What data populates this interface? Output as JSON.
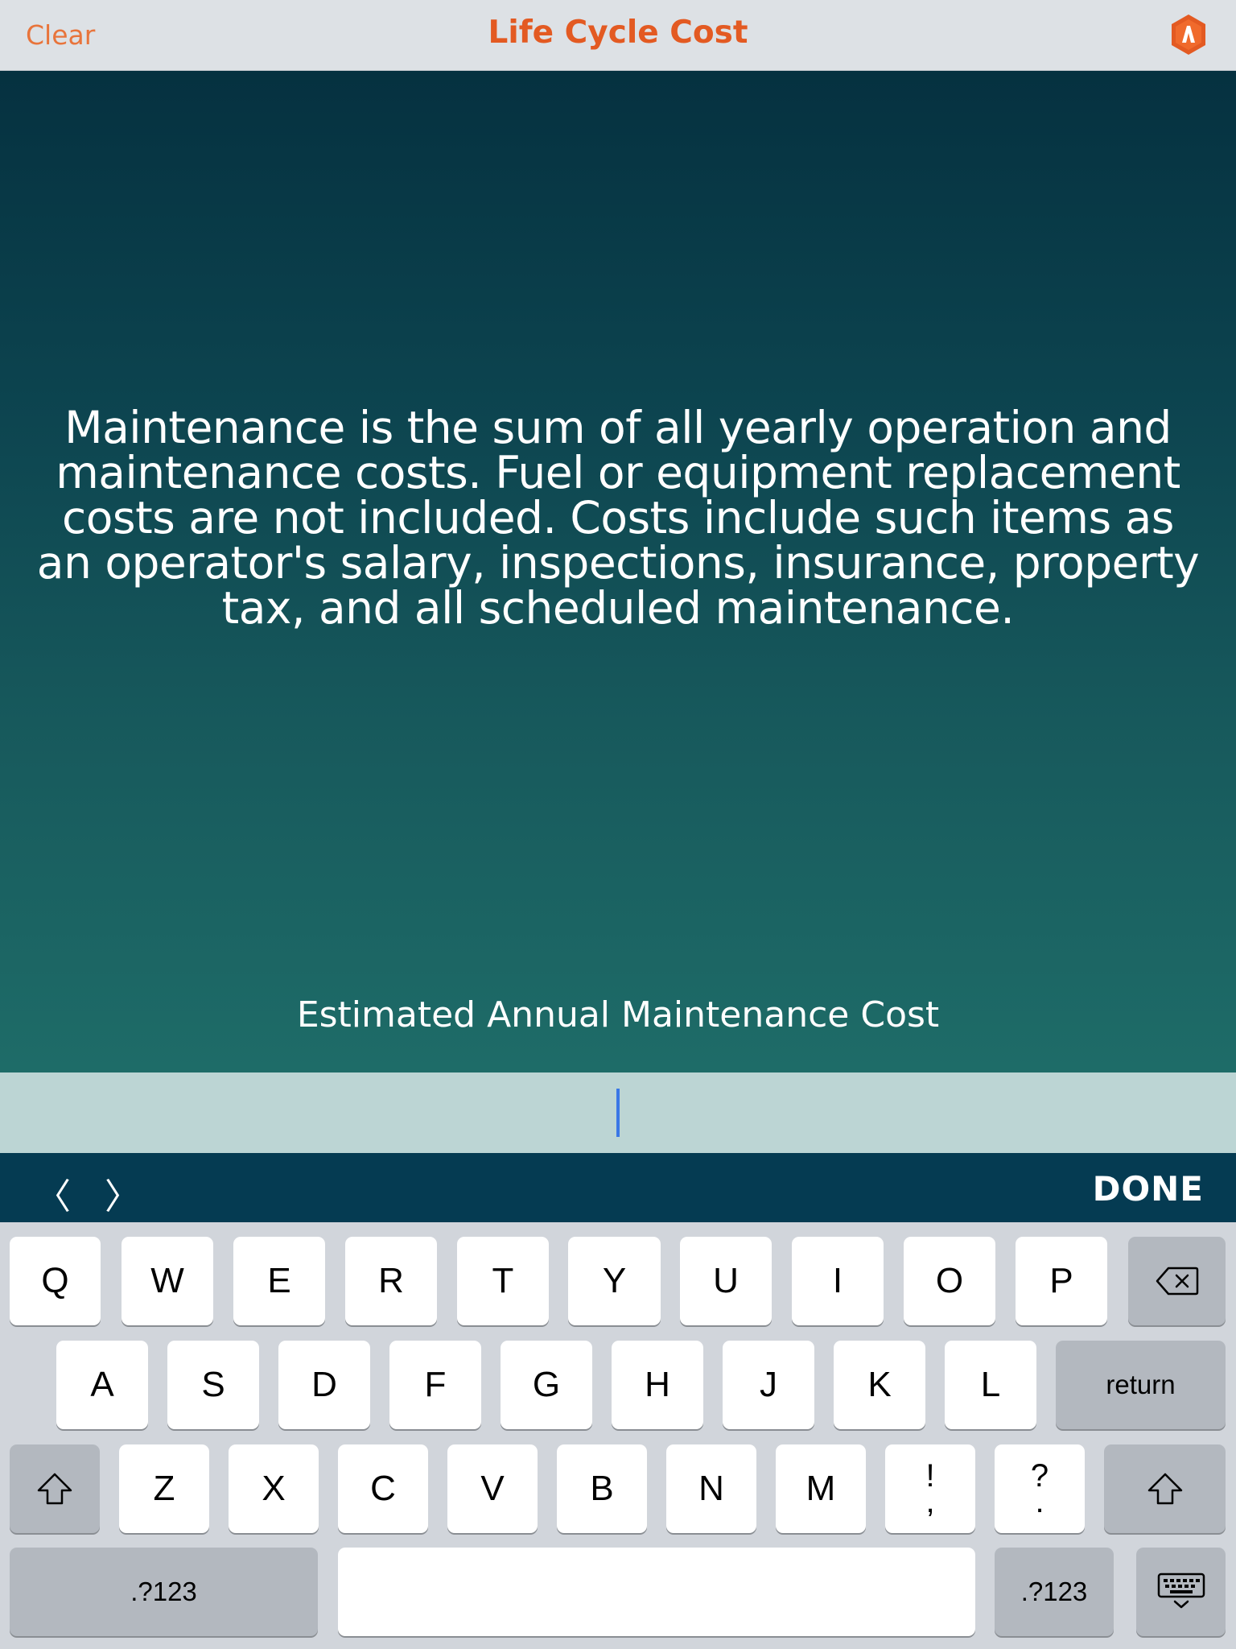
{
  "nav": {
    "clear_label": "Clear",
    "title": "Life Cycle Cost",
    "logo_icon": "app-logo-icon",
    "accent": "#e35a22"
  },
  "main": {
    "description": "Maintenance is the sum of all yearly operation and maintenance costs. Fuel or equipment replacement costs are not included. Costs include such items as an operator's salary, inspections, insurance, property tax, and all scheduled maintenance.",
    "field_label": "Estimated Annual Maintenance Cost",
    "field_value": ""
  },
  "accessory": {
    "prev_label": "〈",
    "next_label": "〉",
    "done_label": "DONE"
  },
  "keyboard": {
    "row1": [
      "Q",
      "W",
      "E",
      "R",
      "T",
      "Y",
      "U",
      "I",
      "O",
      "P"
    ],
    "row2": [
      "A",
      "S",
      "D",
      "F",
      "G",
      "H",
      "J",
      "K",
      "L"
    ],
    "row3": [
      "Z",
      "X",
      "C",
      "V",
      "B",
      "N",
      "M"
    ],
    "exclaim_top": "!",
    "exclaim_bottom": ",",
    "question_top": "?",
    "question_bottom": ".",
    "return_label": "return",
    "numbers_label": ".?123",
    "backspace_icon": "backspace-icon",
    "shift_icon": "shift-icon",
    "dismiss_icon": "keyboard-dismiss-icon"
  }
}
